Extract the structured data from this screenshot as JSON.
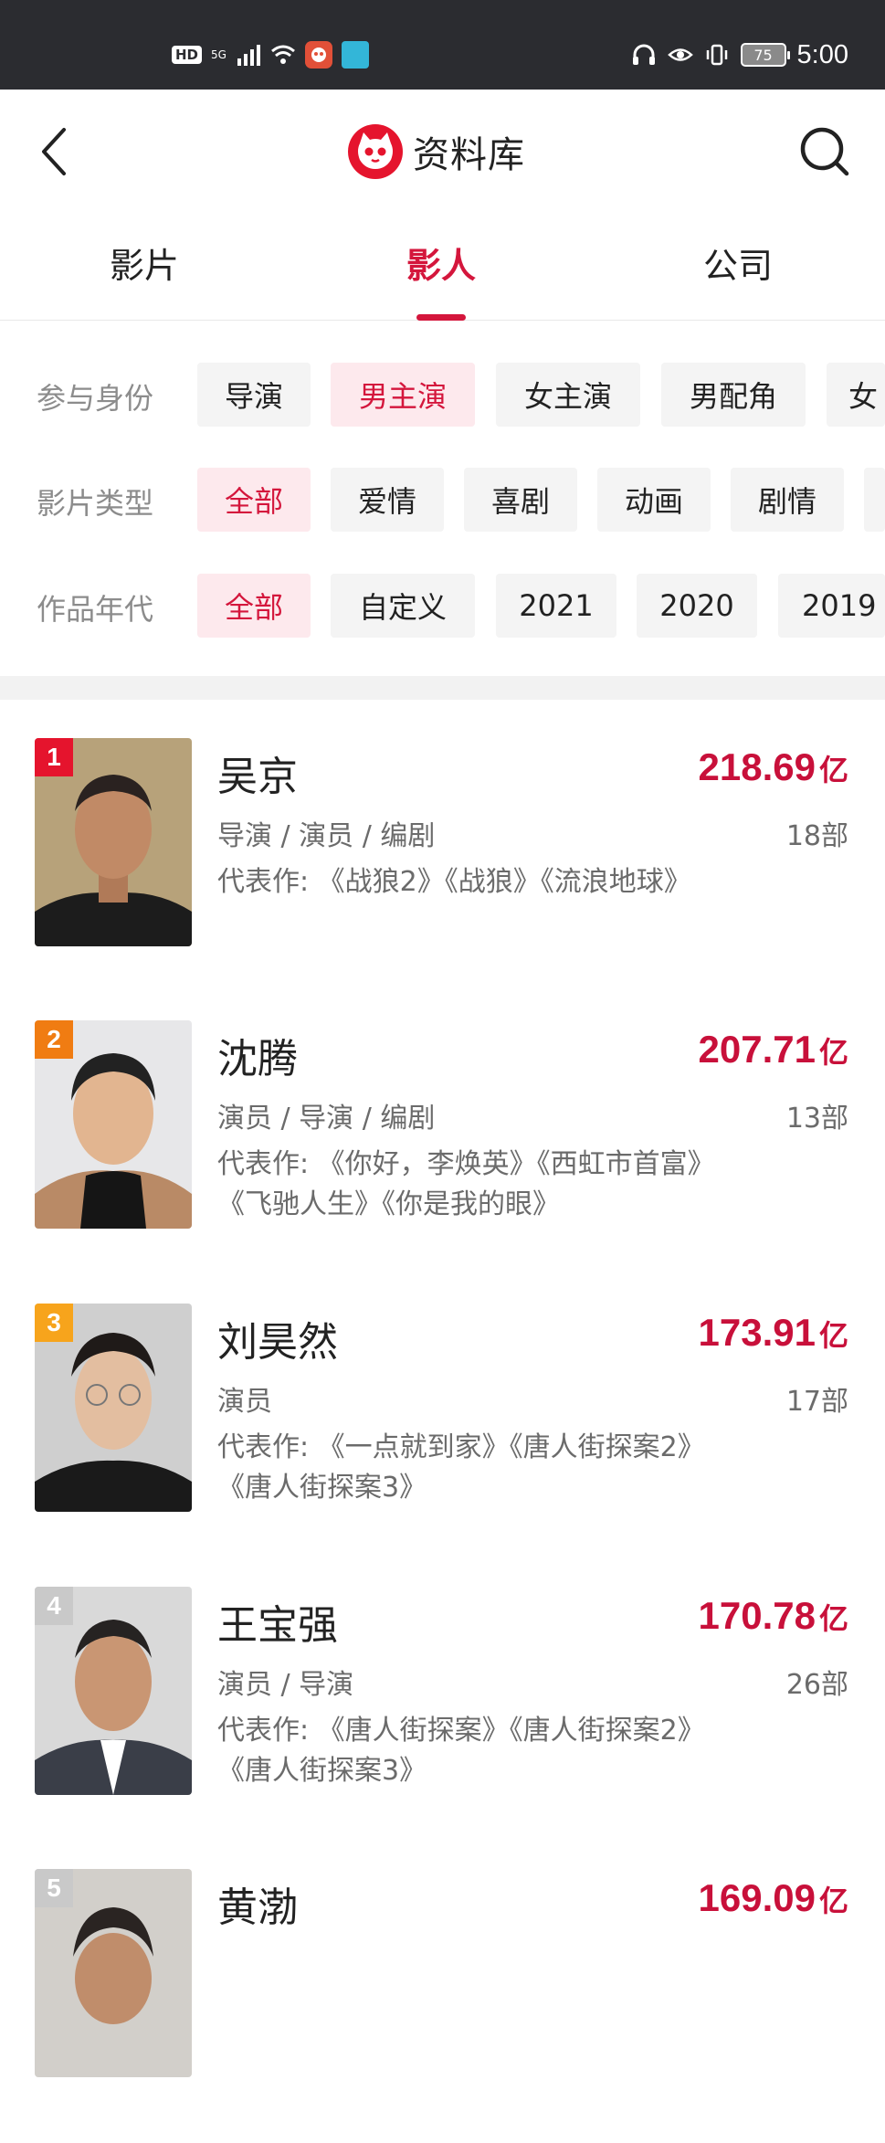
{
  "status_bar": {
    "hd": "HD",
    "signal": "5G",
    "battery": "75",
    "time": "5:00"
  },
  "header": {
    "title": "资料库"
  },
  "tabs": [
    {
      "label": "影片",
      "active": false
    },
    {
      "label": "影人",
      "active": true
    },
    {
      "label": "公司",
      "active": false
    }
  ],
  "filters": {
    "role": {
      "label": "参与身份",
      "options": [
        "导演",
        "男主演",
        "女主演",
        "男配角",
        "女"
      ],
      "selected": "男主演"
    },
    "genre": {
      "label": "影片类型",
      "options": [
        "全部",
        "爱情",
        "喜剧",
        "动画",
        "剧情"
      ],
      "selected": "全部"
    },
    "era": {
      "label": "作品年代",
      "options": [
        "全部",
        "自定义",
        "2021",
        "2020",
        "2019"
      ],
      "selected": "全部"
    }
  },
  "list": [
    {
      "rank": "1",
      "name": "吴京",
      "gross": "218.69",
      "unit": "亿",
      "roles": "导演 / 演员 / 编剧",
      "count": "18部",
      "works": "代表作: 《战狼2》《战狼》《流浪地球》",
      "rank_color": "#e5142d"
    },
    {
      "rank": "2",
      "name": "沈腾",
      "gross": "207.71",
      "unit": "亿",
      "roles": "演员 / 导演 / 编剧",
      "count": "13部",
      "works": "代表作: 《你好，李焕英》《西虹市首富》《飞驰人生》《你是我的眼》",
      "rank_color": "#f07c12"
    },
    {
      "rank": "3",
      "name": "刘昊然",
      "gross": "173.91",
      "unit": "亿",
      "roles": "演员",
      "count": "17部",
      "works": "代表作: 《一点就到家》《唐人街探案2》《唐人街探案3》",
      "rank_color": "#f7a41c"
    },
    {
      "rank": "4",
      "name": "王宝强",
      "gross": "170.78",
      "unit": "亿",
      "roles": "演员 / 导演",
      "count": "26部",
      "works": "代表作: 《唐人街探案》《唐人街探案2》《唐人街探案3》",
      "rank_color": "#c9c9c9"
    },
    {
      "rank": "5",
      "name": "黄渤",
      "gross": "169.09",
      "unit": "亿",
      "roles": "",
      "count": "",
      "works": "",
      "rank_color": "#c9c9c9"
    }
  ]
}
